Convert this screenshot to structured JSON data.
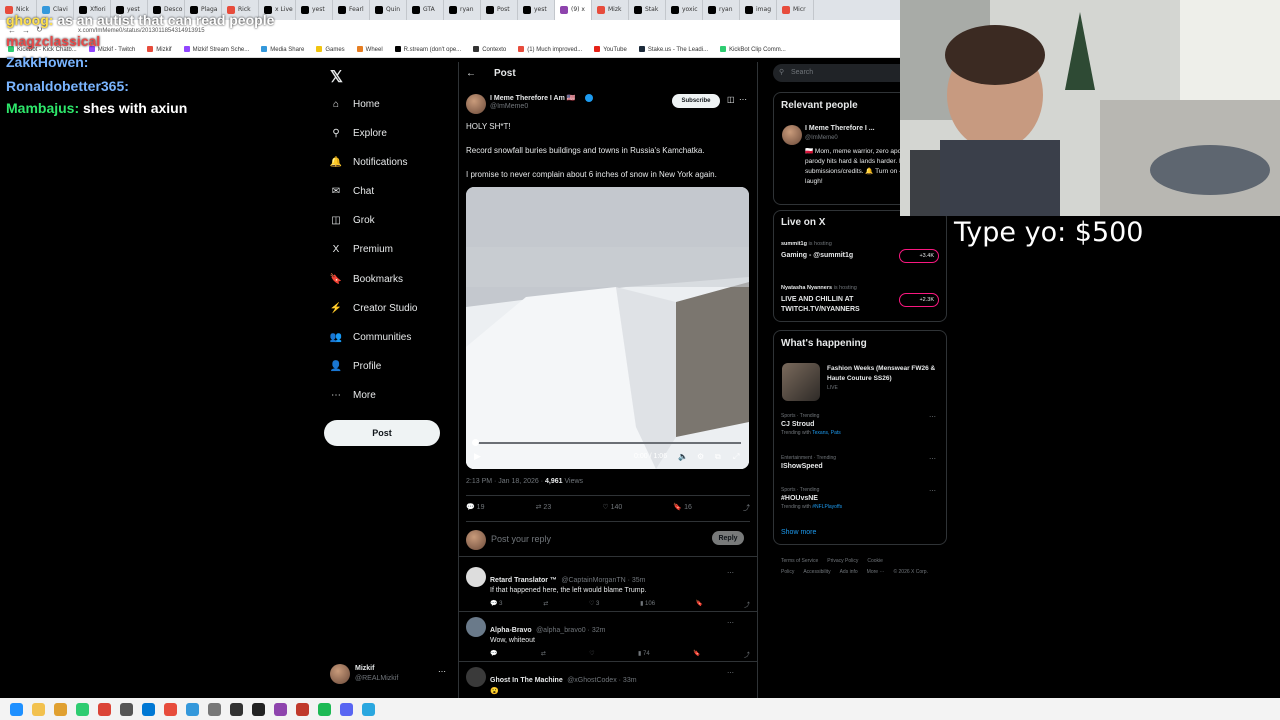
{
  "browser": {
    "tabs": [
      {
        "label": "Nick",
        "color": "#e74c3c"
      },
      {
        "label": "Clavi",
        "color": "#3498db"
      },
      {
        "label": "Xfiori",
        "color": "#000000"
      },
      {
        "label": "yest",
        "color": "#000000"
      },
      {
        "label": "Desco",
        "color": "#000000"
      },
      {
        "label": "Plaga",
        "color": "#000000"
      },
      {
        "label": "Rick",
        "color": "#e74c3c"
      },
      {
        "label": "x Live",
        "color": "#000000"
      },
      {
        "label": "yest",
        "color": "#000000"
      },
      {
        "label": "Fearl",
        "color": "#000000"
      },
      {
        "label": "Quin",
        "color": "#000000"
      },
      {
        "label": "GTA",
        "color": "#000000"
      },
      {
        "label": "ryan",
        "color": "#000000"
      },
      {
        "label": "Post",
        "color": "#000000"
      },
      {
        "label": "yest",
        "color": "#000000"
      },
      {
        "label": "(9) x",
        "color": "#8e44ad"
      },
      {
        "label": "Mizk",
        "color": "#e74c3c"
      },
      {
        "label": "Stak",
        "color": "#000000"
      },
      {
        "label": "yoxic",
        "color": "#000000"
      },
      {
        "label": "ryan",
        "color": "#000000"
      },
      {
        "label": "imag",
        "color": "#000000"
      },
      {
        "label": "Micr",
        "color": "#e74c3c"
      }
    ],
    "url": "x.com/ImMeme0/status/2013011854314913915",
    "bookmarks": [
      {
        "label": "KickBot - Kick Chatb...",
        "color": "#2ecc71"
      },
      {
        "label": "Mizkif - Twitch",
        "color": "#9146ff"
      },
      {
        "label": "Mizkif",
        "color": "#e74c3c"
      },
      {
        "label": "Mizkif Stream Sche...",
        "color": "#9146ff"
      },
      {
        "label": "Media Share",
        "color": "#3498db"
      },
      {
        "label": "Games",
        "color": "#f1c40f"
      },
      {
        "label": "Wheel",
        "color": "#e67e22"
      },
      {
        "label": "R.stream (don't ope...",
        "color": "#000000"
      },
      {
        "label": "Contexto",
        "color": "#333333"
      },
      {
        "label": "(1) Much improved...",
        "color": "#e74c3c"
      },
      {
        "label": "YouTube",
        "color": "#e62117"
      },
      {
        "label": "Stake.us - The Leadi...",
        "color": "#1c2a3a"
      },
      {
        "label": "KickBot Clip Comm...",
        "color": "#2ecc71"
      }
    ]
  },
  "chat": {
    "messages": [
      {
        "user": "ghoog:",
        "text": "as an autist that can read people",
        "color": "#ffe14d",
        "pinned": false
      },
      {
        "user": "magzclassical",
        "text": "",
        "color": "#e84a4a",
        "pinned": false
      },
      {
        "user": "ZakkHowen:",
        "text": "",
        "color": "#7ab5ff",
        "pinned": false
      },
      {
        "user": "Ronaldobetter365:",
        "text": "",
        "color": "#7ab5ff",
        "pinned": false
      },
      {
        "user": "Mambajus:",
        "text": "shes with axiun",
        "color": "#2ee86b",
        "pinned": false
      }
    ]
  },
  "nav": {
    "items": [
      {
        "label": "Home",
        "icon": "home-icon",
        "glyph": "⌂"
      },
      {
        "label": "Explore",
        "icon": "search-icon",
        "glyph": "⚲"
      },
      {
        "label": "Notifications",
        "icon": "bell-icon",
        "glyph": "🔔"
      },
      {
        "label": "Chat",
        "icon": "chat-icon",
        "glyph": "✉"
      },
      {
        "label": "Grok",
        "icon": "grok-icon",
        "glyph": "◫"
      },
      {
        "label": "Premium",
        "icon": "x-logo-icon",
        "glyph": "X"
      },
      {
        "label": "Bookmarks",
        "icon": "bookmark-icon",
        "glyph": "🔖"
      },
      {
        "label": "Creator Studio",
        "icon": "creator-studio-icon",
        "glyph": "⚡"
      },
      {
        "label": "Communities",
        "icon": "communities-icon",
        "glyph": "👥"
      },
      {
        "label": "Profile",
        "icon": "profile-icon",
        "glyph": "👤"
      },
      {
        "label": "More",
        "icon": "more-icon",
        "glyph": "⋯"
      }
    ],
    "post_label": "Post",
    "account": {
      "name": "Mizkif",
      "handle": "@REALMizkif"
    }
  },
  "post": {
    "header": "Post",
    "author": {
      "name": "I Meme Therefore I Am 🇺🇸",
      "handle": "@ImMeme0"
    },
    "subscribe_label": "Subscribe",
    "lines": [
      "HOLY SH*T!",
      "Record snowfall buries buildings and towns in Russia's Kamchatka.",
      "I promise to never complain about 6 inches of snow in New York again."
    ],
    "video": {
      "time": "0:00 / 1:06",
      "progress": 0.0
    },
    "meta_time": "2:13 PM · Jan 18, 2026 · ",
    "meta_views": "4,961",
    "meta_views_label": " Views",
    "stats": {
      "replies": "19",
      "reposts": "23",
      "likes": "140",
      "bookmarks": "16"
    },
    "reply_placeholder": "Post your reply",
    "reply_button": "Reply"
  },
  "replies": [
    {
      "name": "Retard Translator ™",
      "handle": "@CaptainMorganTN · 35m",
      "text": "If that happened here, the left would blame Trump.",
      "stats": {
        "replies": "3",
        "reposts": "",
        "likes": "3",
        "views": "106"
      }
    },
    {
      "name": "Alpha-Bravo",
      "handle": "@alpha_bravo0 · 32m",
      "text": "Wow, whiteout",
      "stats": {
        "replies": "",
        "reposts": "",
        "likes": "",
        "views": "74"
      }
    },
    {
      "name": "Ghost In The Machine",
      "handle": "@xGhostCodex · 33m",
      "text": "😮",
      "stats": {
        "replies": "",
        "reposts": "",
        "likes": "",
        "views": ""
      }
    }
  ],
  "sidebar": {
    "search_placeholder": "Search",
    "relevant": {
      "title": "Relevant people",
      "name": "I Meme Therefore I ...",
      "handle": "@ImMeme0",
      "bio": "🇵🇱 Mom, meme warrior, zero apologies. Political parody hits hard & lands harder. DM submissions/credits. 🔔 Turn on —RT if you laugh!"
    },
    "live": {
      "title": "Live on X",
      "items": [
        {
          "host": "summit1g",
          "hosting": " is hosting",
          "title": "Gaming - @summit1g",
          "count": "+3.4K"
        },
        {
          "host": "Nyatasha Nyanners",
          "hosting": " is hosting",
          "title": "LIVE AND CHILLIN AT TWITCH.TV/NYANNERS",
          "count": "+2.3K"
        }
      ]
    },
    "happening": {
      "title": "What's happening",
      "featured": {
        "title": "Fashion Weeks (Menswear FW26 & Haute Couture SS26)",
        "sub": "LIVE"
      },
      "trends": [
        {
          "cat": "Sports · Trending",
          "name": "CJ Stroud",
          "sub": "Trending with ",
          "with": "Texans, Pats"
        },
        {
          "cat": "Entertainment · Trending",
          "name": "IShowSpeed",
          "sub": "",
          "with": ""
        },
        {
          "cat": "Sports · Trending",
          "name": "#HOUvsNE",
          "sub": "Trending with ",
          "with": "#NFLPlayoffs"
        }
      ],
      "show_more": "Show more"
    },
    "footer": [
      "Terms of Service",
      "Privacy Policy",
      "Cookie Policy",
      "Accessibility",
      "Ads info",
      "More ···",
      "© 2026 X Corp."
    ]
  },
  "overlay": {
    "type_text": "Type yo: $500"
  },
  "colors": {
    "accent": "#1d9bf0",
    "bg": "#000000",
    "border": "#2f3336",
    "muted": "#71767b"
  }
}
